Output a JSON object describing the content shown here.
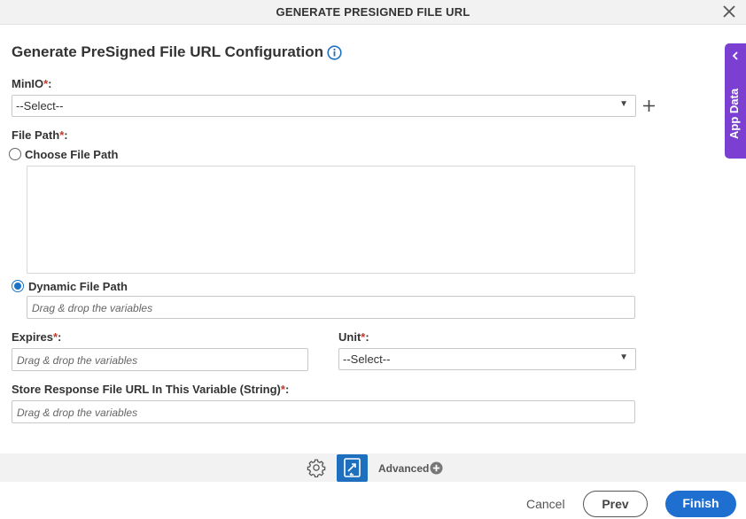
{
  "dialog": {
    "title": "GENERATE PRESIGNED FILE URL"
  },
  "form": {
    "heading": "Generate PreSigned File URL Configuration",
    "minio": {
      "label": "MinIO",
      "required_mark": "*",
      "suffix": ":",
      "selected": "--Select--"
    },
    "file_path": {
      "label": "File Path",
      "required_mark": "*",
      "suffix": ":",
      "choose_label": "Choose File Path",
      "dynamic_label": "Dynamic File Path",
      "dynamic_placeholder": "Drag & drop the variables",
      "selected_option": "Dynamic File Path"
    },
    "expires": {
      "label": "Expires",
      "required_mark": "*",
      "suffix": ":",
      "placeholder": "Drag & drop the variables"
    },
    "unit": {
      "label": "Unit",
      "required_mark": "*",
      "suffix": ":",
      "selected": "--Select--"
    },
    "store_response": {
      "label": "Store Response File URL In This Variable (String)",
      "required_mark": "*",
      "suffix": ":",
      "placeholder": "Drag & drop the variables"
    }
  },
  "side_panel": {
    "label": "App Data"
  },
  "toolbar": {
    "advanced_label": "Advanced"
  },
  "footer": {
    "cancel_label": "Cancel",
    "prev_label": "Prev",
    "finish_label": "Finish"
  },
  "colors": {
    "accent": "#1f6fd1",
    "side_panel": "#7b40d1",
    "required": "#c0392b"
  },
  "icons": [
    "close-icon",
    "info-icon",
    "add-icon",
    "chevron-left-icon",
    "gear-icon",
    "variable-mapping-icon",
    "plus-circle-icon",
    "caret-down-icon"
  ]
}
